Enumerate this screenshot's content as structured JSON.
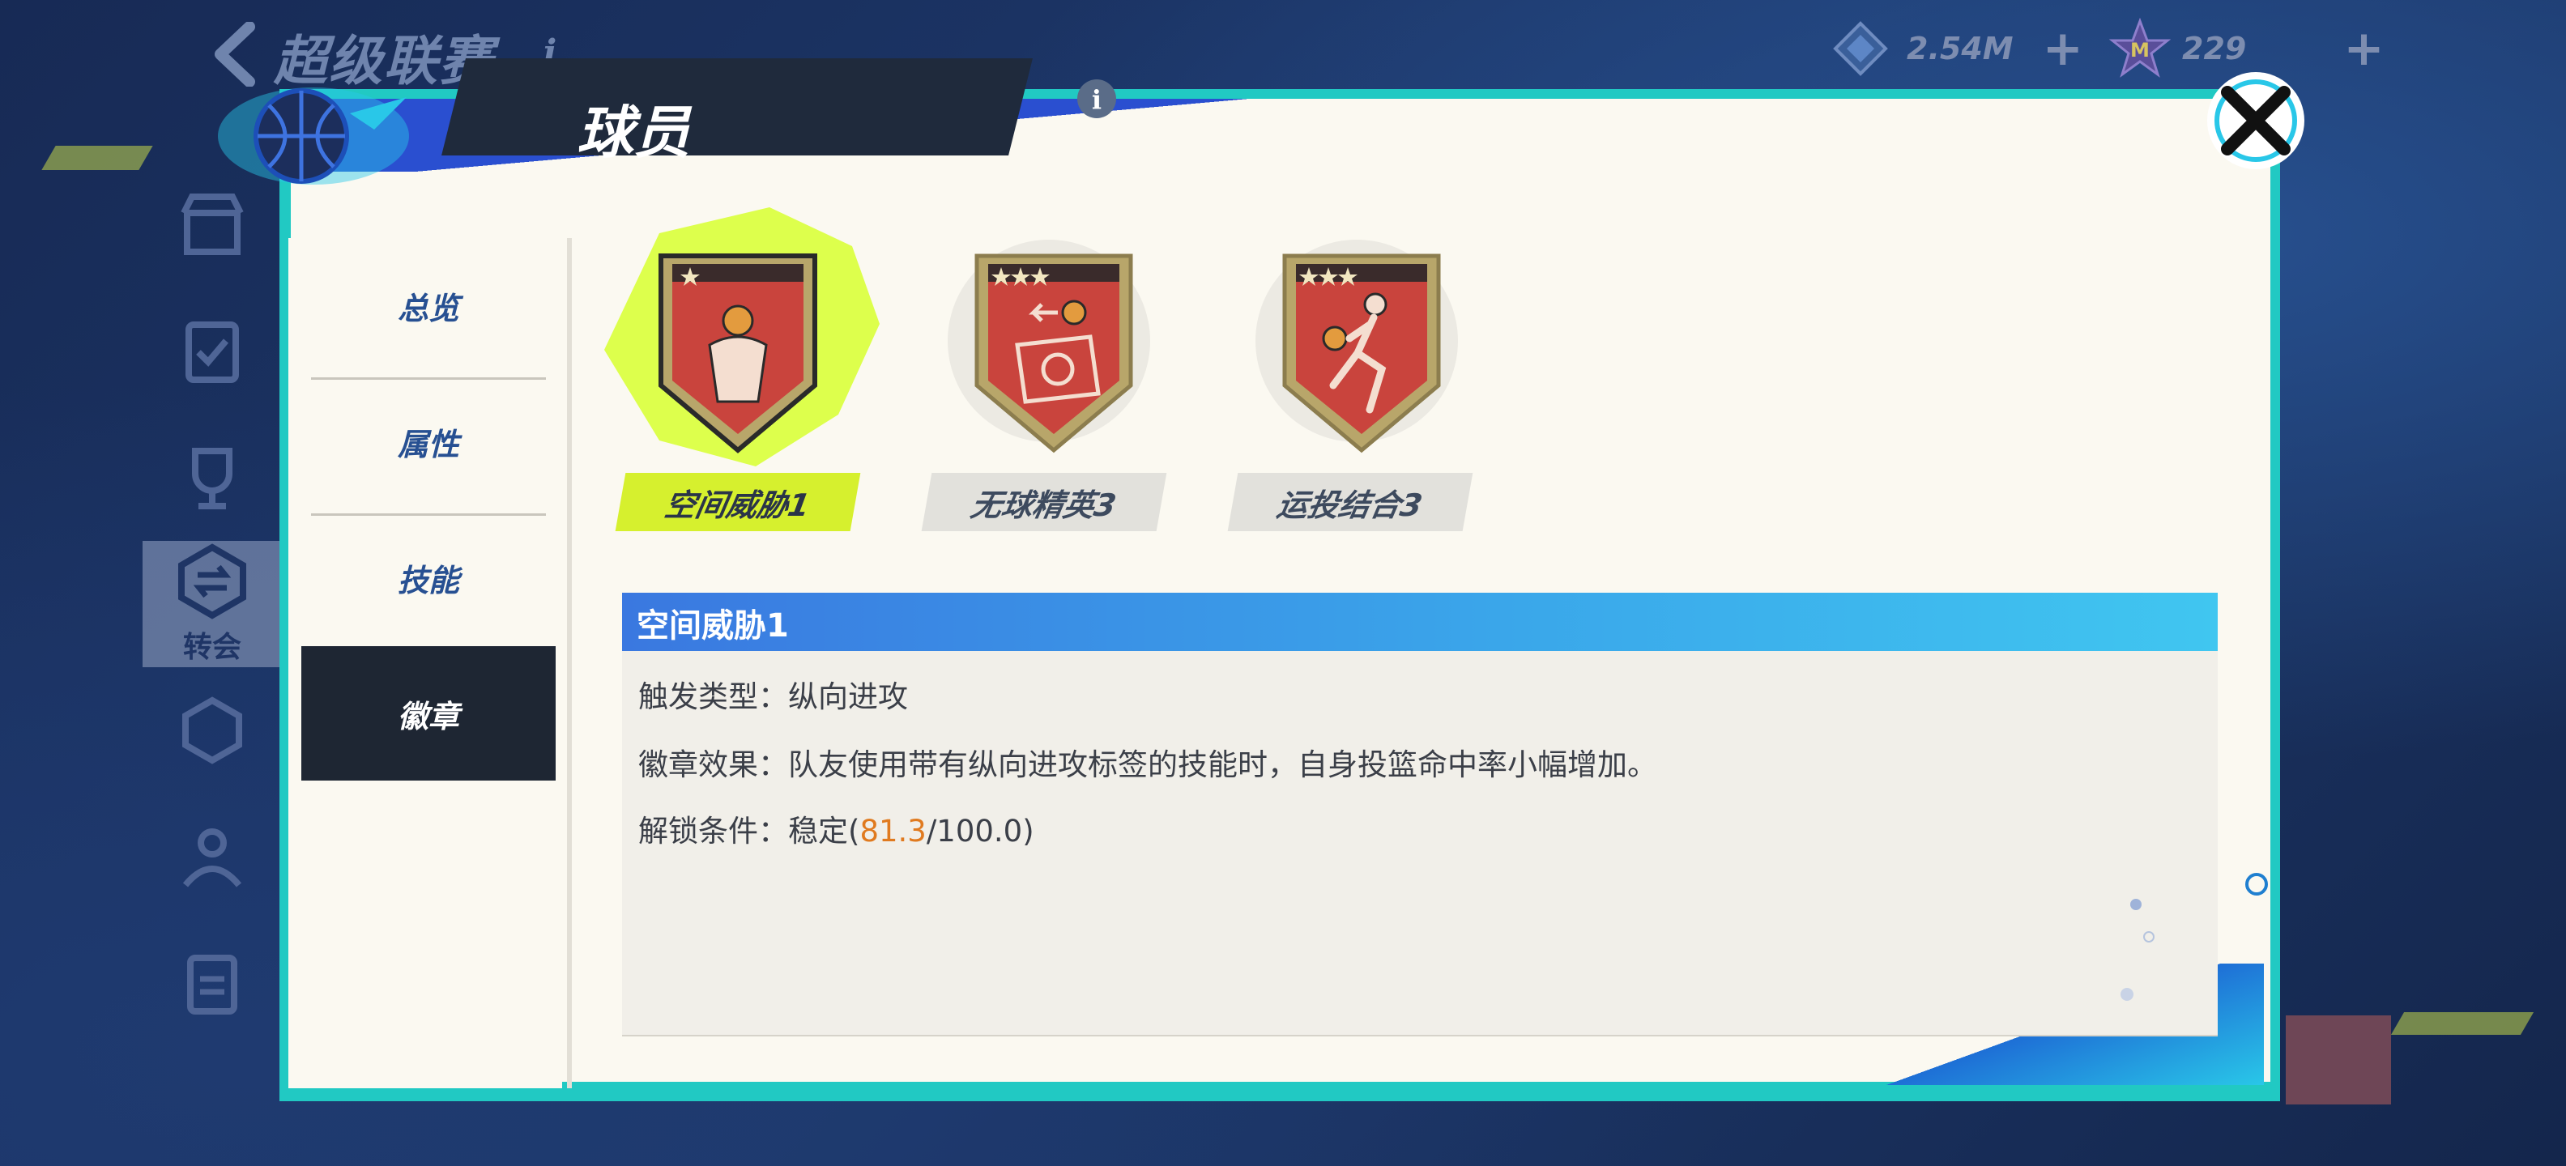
{
  "topbar": {
    "league_title": "超级联赛",
    "currency_1": {
      "icon": "diamond-icon",
      "amount": "2.54M"
    },
    "currency_2": {
      "icon": "star-coin-icon",
      "amount": "229"
    }
  },
  "rail": {
    "active_label": "转会"
  },
  "panel": {
    "title": "球员"
  },
  "sidenav": {
    "items": [
      {
        "label": "总览"
      },
      {
        "label": "属性"
      },
      {
        "label": "技能"
      },
      {
        "label": "徽章"
      }
    ],
    "active_index": 3
  },
  "badges": [
    {
      "name": "空间威胁1",
      "stars": 1,
      "selected": true
    },
    {
      "name": "无球精英3",
      "stars": 3,
      "selected": false
    },
    {
      "name": "运投结合3",
      "stars": 3,
      "selected": false
    }
  ],
  "detail": {
    "title": "空间威胁1",
    "trigger_label": "触发类型：",
    "trigger_value": "纵向进攻",
    "effect_label": "徽章效果：",
    "effect_value": "队友使用带有纵向进攻标签的技能时，自身投篮命中率小幅增加。",
    "unlock_label": "解锁条件：",
    "unlock_prefix": "稳定(",
    "unlock_current": "81.3",
    "unlock_suffix": "/100.0)"
  },
  "colors": {
    "accent_lime": "#d6f02e",
    "accent_cyan": "#21c9c3",
    "highlight_orange": "#e07a1f",
    "dark_nav": "#1e2633"
  }
}
